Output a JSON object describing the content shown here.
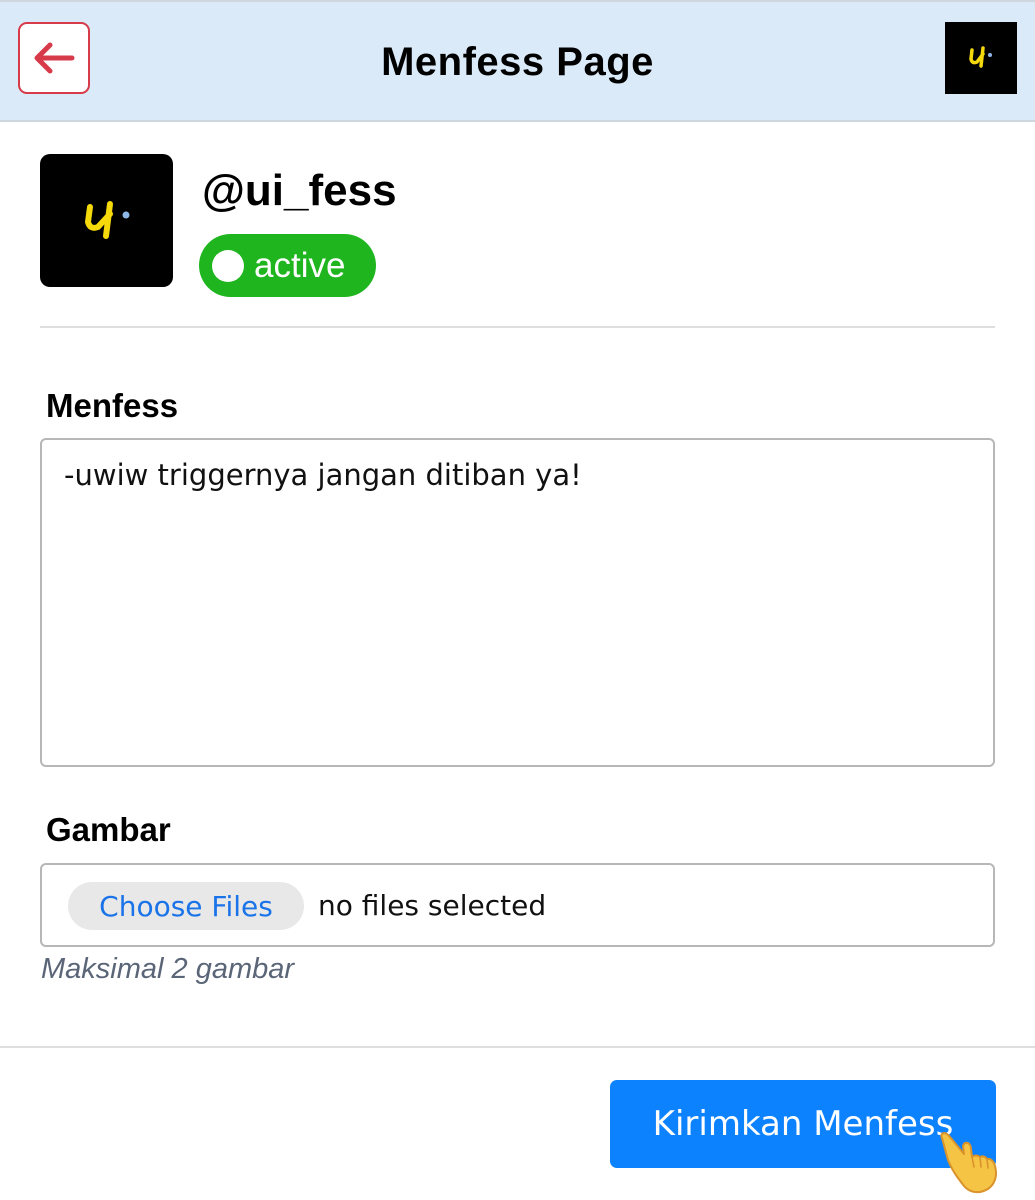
{
  "header": {
    "title": "Menfess Page",
    "back_icon": "arrow-left-icon",
    "accent_color": "#d73a49",
    "background_color": "#dbeaf9"
  },
  "profile": {
    "handle": "@ui_fess",
    "status": "active",
    "status_color": "#1fb51f"
  },
  "form": {
    "menfess_label": "Menfess",
    "menfess_value": "-uwiw triggernya jangan ditiban ya!",
    "gambar_label": "Gambar",
    "choose_files_label": "Choose Files",
    "file_status": "no files selected",
    "hint": "Maksimal 2 gambar"
  },
  "footer": {
    "submit_label": "Kirimkan Menfess",
    "submit_color": "#0d82ff",
    "cursor_icon": "pointing-hand-icon"
  }
}
